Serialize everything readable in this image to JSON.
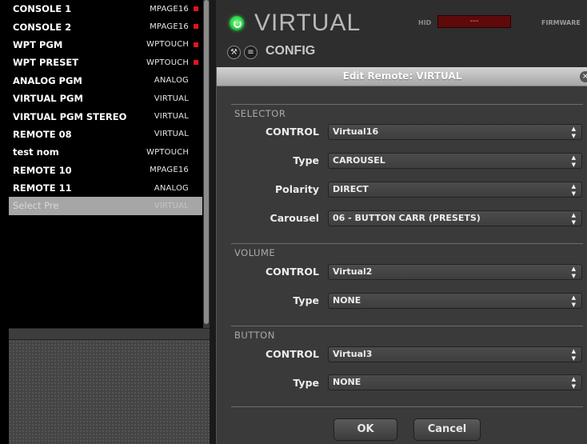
{
  "remotes": {
    "items": [
      {
        "name": "CONSOLE 1",
        "type": "MPAGE16",
        "indicator": true
      },
      {
        "name": "CONSOLE 2",
        "type": "MPAGE16",
        "indicator": true
      },
      {
        "name": "WPT PGM",
        "type": "WPTOUCH",
        "indicator": true
      },
      {
        "name": "WPT PRESET",
        "type": "WPTOUCH",
        "indicator": true
      },
      {
        "name": "ANALOG PGM",
        "type": "ANALOG",
        "indicator": false
      },
      {
        "name": "VIRTUAL PGM",
        "type": "VIRTUAL",
        "indicator": false
      },
      {
        "name": "VIRTUAL PGM STEREO",
        "type": "VIRTUAL",
        "indicator": false
      },
      {
        "name": "REMOTE 08",
        "type": "VIRTUAL",
        "indicator": false
      },
      {
        "name": "test nom",
        "type": "WPTOUCH",
        "indicator": false
      },
      {
        "name": "REMOTE 10",
        "type": "MPAGE16",
        "indicator": false
      },
      {
        "name": "REMOTE 11",
        "type": "ANALOG",
        "indicator": false
      },
      {
        "name": "Select Pre",
        "type": "VIRTUAL",
        "indicator": false,
        "selected": true
      }
    ],
    "indicator_color": "#e1141e"
  },
  "header": {
    "title": "VIRTUAL",
    "hid_label": "HID",
    "hid_value": "---",
    "firmware_label": "FIRMWARE",
    "config_label": "CONFIG",
    "power_color": "#2bd14a"
  },
  "dialog": {
    "title": "Edit Remote: VIRTUAL",
    "close_glyph": "×",
    "selector": {
      "section": "SELECTOR",
      "control_label": "CONTROL",
      "control_value": "Virtual16",
      "type_label": "Type",
      "type_value": "CAROUSEL",
      "polarity_label": "Polarity",
      "polarity_value": "DIRECT",
      "carousel_label": "Carousel",
      "carousel_value": "06 - BUTTON CARR (PRESETS)"
    },
    "volume": {
      "section": "VOLUME",
      "control_label": "CONTROL",
      "control_value": "Virtual2",
      "type_label": "Type",
      "type_value": "NONE"
    },
    "button": {
      "section": "BUTTON",
      "control_label": "CONTROL",
      "control_value": "Virtual3",
      "type_label": "Type",
      "type_value": "NONE"
    },
    "ok_label": "OK",
    "cancel_label": "Cancel"
  }
}
